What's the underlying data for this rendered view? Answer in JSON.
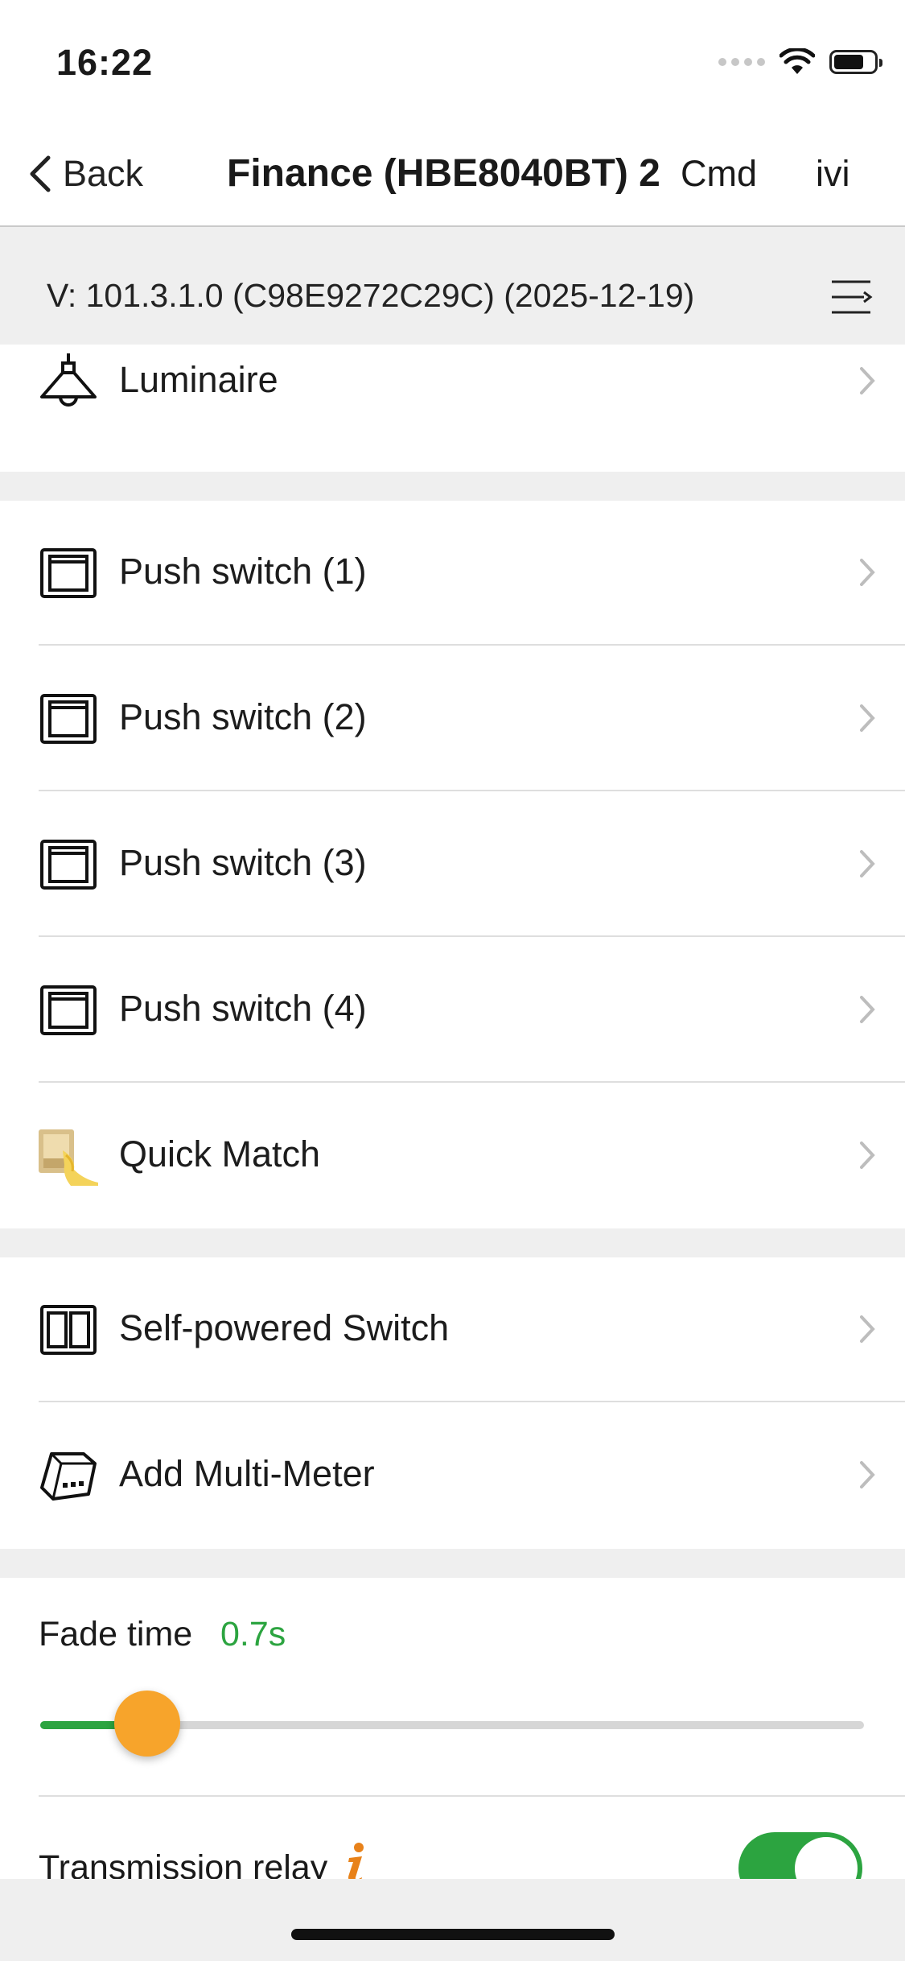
{
  "status_bar": {
    "time": "16:22",
    "icons": [
      "signal-dots-icon",
      "wifi-icon",
      "battery-icon"
    ]
  },
  "nav": {
    "back_label": "Back",
    "title": "Finance (HBE8040BT) 2",
    "cmd_label": "Cmd",
    "ivi_label": "ivi"
  },
  "version_bar": {
    "text": "V: 101.3.1.0  (C98E9272C29C) (2025-12-19)",
    "menu_icon": "list-menu-icon"
  },
  "sections": [
    {
      "items": [
        {
          "label": "Luminaire",
          "icon": "lamp-icon"
        }
      ]
    },
    {
      "items": [
        {
          "label": "Push switch (1)",
          "icon": "push-switch-icon"
        },
        {
          "label": "Push switch (2)",
          "icon": "push-switch-icon"
        },
        {
          "label": "Push switch (3)",
          "icon": "push-switch-icon"
        },
        {
          "label": "Push switch (4)",
          "icon": "push-switch-icon"
        },
        {
          "label": "Quick Match",
          "icon": "quick-match-icon"
        }
      ]
    },
    {
      "items": [
        {
          "label": "Self-powered Switch",
          "icon": "double-switch-icon"
        },
        {
          "label": "Add Multi-Meter",
          "icon": "multi-meter-icon"
        }
      ]
    }
  ],
  "fade": {
    "label": "Fade time",
    "value": "0.7s",
    "slider_fraction": 0.13
  },
  "relay": {
    "label": "Transmission relay",
    "info_icon": "info-icon",
    "enabled": true
  },
  "colors": {
    "accent_green": "#2ca440",
    "slider_thumb": "#f7a42b",
    "info_orange": "#e8821a",
    "background_gray": "#efefef"
  }
}
